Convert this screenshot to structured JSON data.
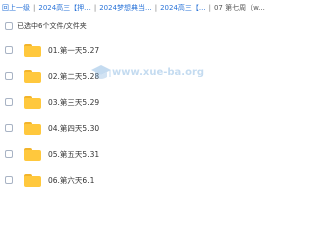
{
  "breadcrumb": {
    "items": [
      "回上一级",
      "2024高三【押...",
      "2024梦想典当...",
      "2024高三【...",
      "07 第七周（w..."
    ],
    "separator": "|"
  },
  "selection": {
    "text": "已选中6个文件/文件夹"
  },
  "files": [
    {
      "name": "01.第一天5.27",
      "icon": "folder-icon"
    },
    {
      "name": "02.第二天5.28",
      "icon": "folder-icon"
    },
    {
      "name": "03.第三天5.29",
      "icon": "folder-icon"
    },
    {
      "name": "04.第四天5.30",
      "icon": "folder-icon"
    },
    {
      "name": "05.第五天5.31",
      "icon": "folder-icon"
    },
    {
      "name": "06.第六天6.1",
      "icon": "folder-icon"
    }
  ],
  "watermark": {
    "text": "www.xue-ba.org"
  },
  "colors": {
    "link": "#2b74d8",
    "folder": "#ffc83d",
    "watermark": "#5a9bd5"
  }
}
